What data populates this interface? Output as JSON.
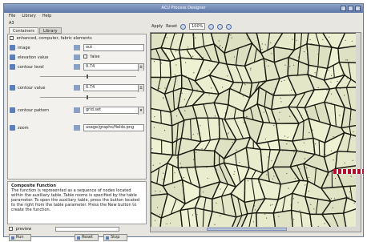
{
  "window": {
    "title": "ACU Process Designer"
  },
  "menubar": {
    "file": "File",
    "library": "Library",
    "help": "Help"
  },
  "left": {
    "section_label": "A3",
    "tabs": [
      {
        "label": "Containers"
      },
      {
        "label": "Library"
      }
    ],
    "enhanced_label": "enhanced, computer, fabric elements",
    "rows": [
      {
        "label": "image",
        "value": "out"
      },
      {
        "label": "elevation value",
        "value": "false"
      },
      {
        "label": "contour level",
        "value": "0.74"
      },
      {
        "label": "contour value",
        "value": "0.74"
      },
      {
        "label": "contour pattern",
        "value": "grid.set"
      },
      {
        "label": "zoom",
        "value": "usage/graphs/fields.png"
      }
    ],
    "description": {
      "title": "Composite Function",
      "text": "The function is represented as a sequence of nodes located within the auxiliary table. Table rooms is specified by the table parameter. To open the auxiliary table, press the button located to the right from the table parameter. Press the New button to create the function."
    },
    "preview_label": "preview",
    "buttons": {
      "run": "Run",
      "reset": "Reset",
      "stop": "Stop"
    }
  },
  "right": {
    "toolbar": {
      "apply_label": "Apply",
      "reset_label": "Reset",
      "zoom_value": "100%"
    }
  },
  "colors": {
    "accent": "#5d7eb6",
    "image_bg": "#dfe3c9",
    "cell_border": "#1a1a12",
    "marker": "#b30d2d"
  }
}
